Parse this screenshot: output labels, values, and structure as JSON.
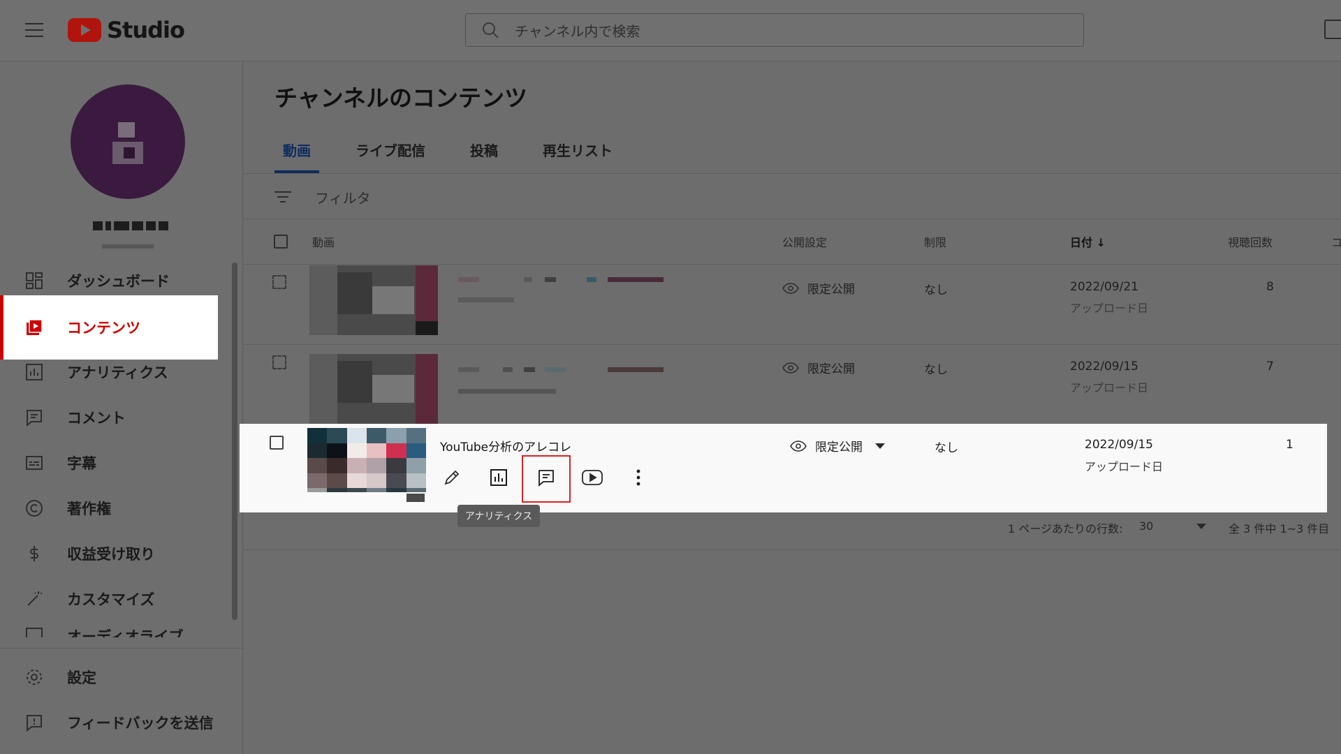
{
  "app": {
    "title": "Studio"
  },
  "search": {
    "placeholder": "チャンネル内で検索"
  },
  "sidebar": {
    "items": [
      {
        "label": "ダッシュボード",
        "icon": "dashboard-icon"
      },
      {
        "label": "コンテンツ",
        "icon": "content-icon",
        "active": true
      },
      {
        "label": "アナリティクス",
        "icon": "analytics-icon"
      },
      {
        "label": "コメント",
        "icon": "comment-icon"
      },
      {
        "label": "字幕",
        "icon": "subtitles-icon"
      },
      {
        "label": "著作権",
        "icon": "copyright-icon"
      },
      {
        "label": "収益受け取り",
        "icon": "dollar-icon"
      },
      {
        "label": "カスタマイズ",
        "icon": "magic-wand-icon"
      },
      {
        "label": "オーディオライブ",
        "icon": "audio-library-icon"
      }
    ],
    "bottom": [
      {
        "label": "設定",
        "icon": "gear-icon"
      },
      {
        "label": "フィードバックを送信",
        "icon": "feedback-icon"
      }
    ]
  },
  "main": {
    "title": "チャンネルのコンテンツ",
    "tabs": [
      {
        "label": "動画",
        "active": true
      },
      {
        "label": "ライブ配信"
      },
      {
        "label": "投稿"
      },
      {
        "label": "再生リスト"
      }
    ],
    "filter_placeholder": "フィルタ"
  },
  "table": {
    "headers": {
      "video": "動画",
      "visibility": "公開設定",
      "restrictions": "制限",
      "date": "日付",
      "views": "視聴回数",
      "comments": "コ"
    },
    "rows": [
      {
        "title": "",
        "visibility": "限定公開",
        "restrictions": "なし",
        "date": "2022/09/21",
        "date_type": "アップロード日",
        "views": "8"
      },
      {
        "title": "",
        "visibility": "限定公開",
        "restrictions": "なし",
        "date": "2022/09/15",
        "date_type": "アップロード日",
        "views": "7"
      },
      {
        "title": "YouTube分析のアレコレ",
        "visibility": "限定公開",
        "restrictions": "なし",
        "date": "2022/09/15",
        "date_type": "アップロード日",
        "views": "1"
      }
    ],
    "hover_actions": [
      "pencil-icon",
      "analytics-icon",
      "comment-icon",
      "youtube-icon",
      "more-vert-icon"
    ],
    "tooltip": "アナリティクス"
  },
  "pagination": {
    "rows_label": "1 ページあたりの行数:",
    "rows_value": "30",
    "range": "全 3 件中 1~3 件目"
  },
  "colors": {
    "accent": "#cc0000",
    "tab_active": "#0d2c5e",
    "highlight_box": "#e02020"
  }
}
